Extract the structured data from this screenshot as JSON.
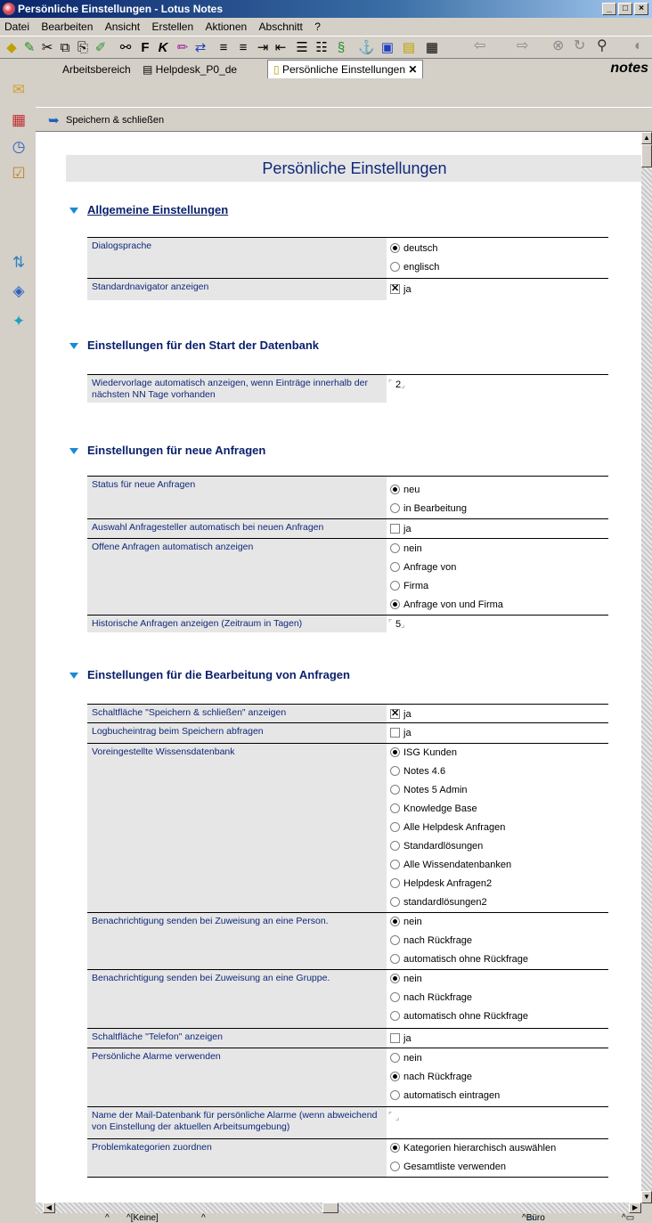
{
  "window": {
    "title": "Persönliche Einstellungen - Lotus Notes"
  },
  "menu": [
    "Datei",
    "Bearbeiten",
    "Ansicht",
    "Erstellen",
    "Aktionen",
    "Abschnitt",
    "?"
  ],
  "tabs": [
    "Arbeitsbereich",
    "Helpdesk_P0_de",
    "Persönliche Einstellungen"
  ],
  "brand": "notes",
  "action": {
    "save_label": "Speichern & schließen"
  },
  "doc": {
    "title": "Persönliche Einstellungen"
  },
  "sections": {
    "s1": "Allgemeine Einstellungen",
    "s2": "Einstellungen für den Start der Datenbank",
    "s3": "Einstellungen für neue Anfragen",
    "s4": "Einstellungen für die Bearbeitung von Anfragen"
  },
  "rows": {
    "r1": {
      "label": "Dialogsprache",
      "opts": [
        "deutsch",
        "englisch"
      ]
    },
    "r2": {
      "label": "Standardnavigator anzeigen",
      "opts": [
        "ja"
      ]
    },
    "r3": {
      "label": "Wiedervorlage automatisch anzeigen, wenn Einträge innerhalb der nächsten NN Tage vorhanden",
      "value": "2"
    },
    "r4": {
      "label": "Status für neue Anfragen",
      "opts": [
        "neu",
        "in Bearbeitung"
      ]
    },
    "r5": {
      "label": "Auswahl Anfragesteller automatisch bei neuen Anfragen",
      "opts": [
        "ja"
      ]
    },
    "r6": {
      "label": "Offene Anfragen automatisch anzeigen",
      "opts": [
        "nein",
        "Anfrage von",
        "Firma",
        "Anfrage von und Firma"
      ]
    },
    "r7": {
      "label": "Historische Anfragen anzeigen (Zeitraum in Tagen)",
      "value": "5"
    },
    "r8": {
      "label": "Schaltfläche \"Speichern & schließen\" anzeigen",
      "opts": [
        "ja"
      ]
    },
    "r9": {
      "label": "Logbucheintrag beim Speichern abfragen",
      "opts": [
        "ja"
      ]
    },
    "r10": {
      "label": "Voreingestellte Wissensdatenbank",
      "opts": [
        "ISG Kunden",
        "Notes 4.6",
        "Notes 5 Admin",
        "Knowledge Base",
        "Alle Helpdesk Anfragen",
        "Standardlösungen",
        "Alle Wissendatenbanken",
        "Helpdesk Anfragen2",
        "standardlösungen2"
      ]
    },
    "r11": {
      "label": "Benachrichtigung senden bei Zuweisung an eine Person.",
      "opts": [
        "nein",
        "nach Rückfrage",
        "automatisch ohne Rückfrage"
      ]
    },
    "r12": {
      "label": "Benachrichtigung senden bei Zuweisung an eine Gruppe.",
      "opts": [
        "nein",
        "nach Rückfrage",
        "automatisch ohne Rückfrage"
      ]
    },
    "r13": {
      "label": "Schaltfläche \"Telefon\" anzeigen",
      "opts": [
        "ja"
      ]
    },
    "r14": {
      "label": "Persönliche Alarme verwenden",
      "opts": [
        "nein",
        "nach Rückfrage",
        "automatisch eintragen"
      ]
    },
    "r15": {
      "label": "Name der Mail-Datenbank für persönliche Alarme (wenn abweichend von Einstellung der aktuellen Arbeitsumgebung)",
      "value": ""
    },
    "r16": {
      "label": "Problemkategorien zuordnen",
      "opts": [
        "Kategorien hierarchisch auswählen",
        "Gesamtliste verwenden"
      ]
    }
  },
  "status": {
    "keine": "[Keine]",
    "location": "Büro"
  }
}
